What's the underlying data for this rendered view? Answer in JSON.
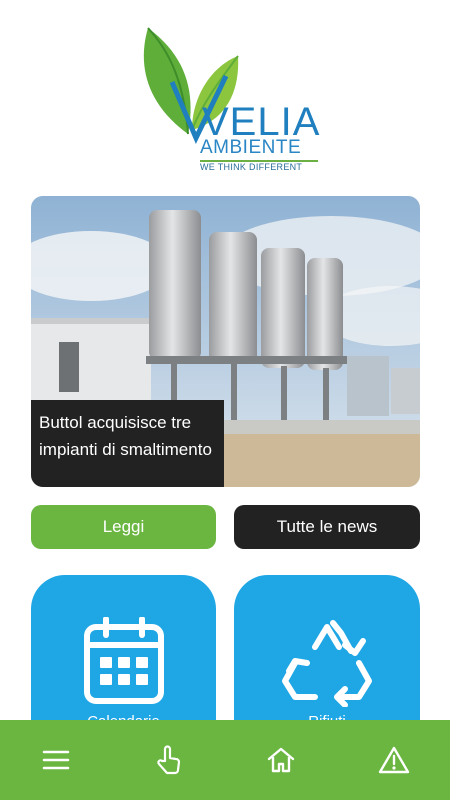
{
  "brand": {
    "name": "VELIA",
    "subtitle": "AMBIENTE",
    "tagline": "WE THINK DIFFERENT",
    "colors": {
      "leaf": "#6cb043",
      "blue": "#1f7fbf"
    }
  },
  "news": {
    "title": "Buttol acquisisce tre impianti di smaltimento",
    "read_label": "Leggi",
    "all_news_label": "Tutte le news"
  },
  "tiles": [
    {
      "icon": "calendar-icon",
      "label": "Calendario"
    },
    {
      "icon": "recycle-icon",
      "label": "Rifiuti"
    }
  ],
  "bottom_nav": [
    {
      "icon": "menu-icon"
    },
    {
      "icon": "hand-pointer-icon"
    },
    {
      "icon": "home-icon"
    },
    {
      "icon": "warning-icon"
    }
  ],
  "colors": {
    "green": "#6ab641",
    "dark": "#222222",
    "tile_blue": "#1fa6e4"
  }
}
